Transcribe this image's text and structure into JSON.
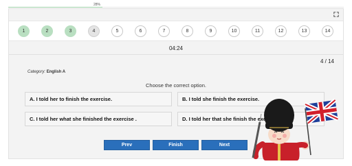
{
  "progress": {
    "label": "28%",
    "fraction": 0.28
  },
  "nav": {
    "questions": [
      {
        "label": "1",
        "state": "done"
      },
      {
        "label": "2",
        "state": "done"
      },
      {
        "label": "3",
        "state": "done"
      },
      {
        "label": "4",
        "state": "current"
      },
      {
        "label": "5",
        "state": "pending"
      },
      {
        "label": "6",
        "state": "pending"
      },
      {
        "label": "7",
        "state": "pending"
      },
      {
        "label": "8",
        "state": "pending"
      },
      {
        "label": "9",
        "state": "pending"
      },
      {
        "label": "10",
        "state": "pending"
      },
      {
        "label": "11",
        "state": "pending"
      },
      {
        "label": "12",
        "state": "pending"
      },
      {
        "label": "13",
        "state": "pending"
      },
      {
        "label": "14",
        "state": "pending"
      }
    ]
  },
  "timer": "04:24",
  "counter": "4 / 14",
  "category": {
    "key": "Category:",
    "value": "English A"
  },
  "prompt": "Choose the correct option.",
  "options": {
    "a": "A. I told her to finish the exercise.",
    "b": "B. I told she finish the exercise.",
    "c": "C. I told her what she finished the exercise .",
    "d": "D. I told her that she finish the exercise."
  },
  "buttons": {
    "prev": "Prev",
    "finish": "Finish",
    "next": "Next"
  },
  "colors": {
    "done": "#b9dfc1",
    "current": "#e4e4e4",
    "button": "#2a6fbb"
  },
  "icons": {
    "fullscreen": "fullscreen-icon",
    "mascot": "royal-guard-flag-mascot"
  }
}
